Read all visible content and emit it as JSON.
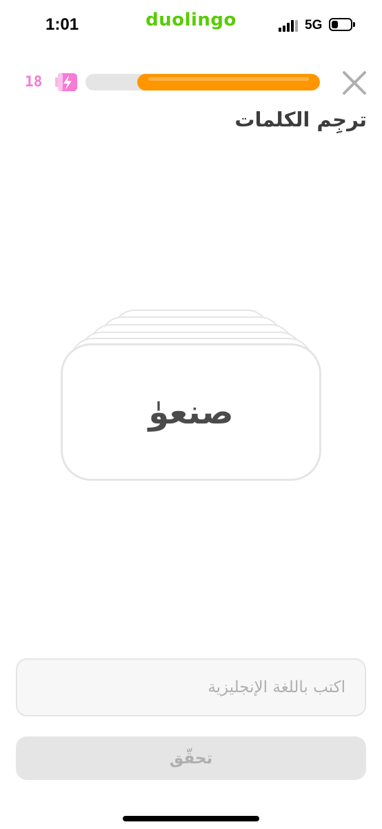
{
  "status_bar": {
    "time": "1:01",
    "app_name": "duolingo",
    "network": "5G",
    "signal_icon": "signal-bars-icon",
    "battery_icon": "battery-icon",
    "battery_level": 0.35
  },
  "lesson_header": {
    "energy_count": "18",
    "energy_icon": "lightning-battery-icon",
    "progress": 0.78,
    "close_icon": "close-icon",
    "colors": {
      "progress": "#ff9600",
      "energy": "#f77ad4"
    }
  },
  "prompt": {
    "title": "ترجِم الكلمات"
  },
  "card": {
    "word": "صنعوٰ"
  },
  "answer": {
    "placeholder": "اكتب باللغة الإنجليزية",
    "value": ""
  },
  "check_button": {
    "label": "تحقّق"
  },
  "colors": {
    "brand": "#58cc02",
    "accent": "#ff9600"
  }
}
